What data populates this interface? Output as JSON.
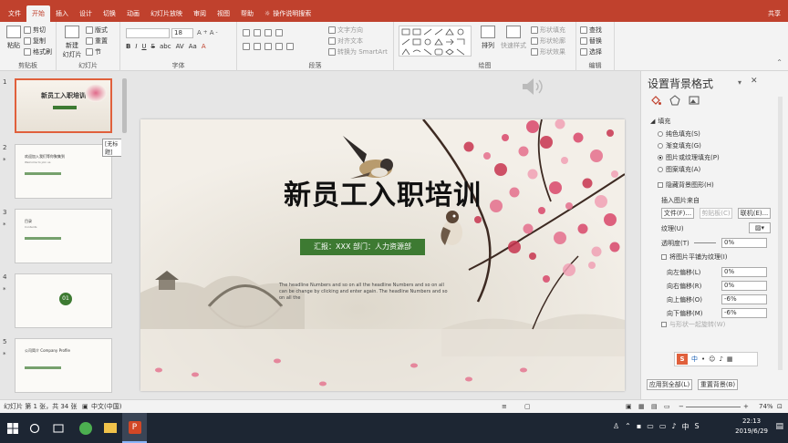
{
  "menu": {
    "tabs": [
      "文件",
      "开始",
      "插入",
      "设计",
      "切换",
      "动画",
      "幻灯片放映",
      "审阅",
      "视图",
      "帮助"
    ],
    "active_tab": "开始",
    "tell_me": "操作说明搜索",
    "share": "共享"
  },
  "ribbon": {
    "clipboard": {
      "paste": "粘贴",
      "cut": "剪切",
      "copy": "复制",
      "format_painter": "格式刷",
      "label": "剪贴板"
    },
    "slides": {
      "new_slide": "新建\n幻灯片",
      "layout": "版式",
      "reset": "重置",
      "section": "节",
      "label": "幻灯片"
    },
    "font": {
      "size": "18",
      "label": "字体",
      "buttons": [
        "B",
        "I",
        "U",
        "S",
        "abc",
        "AV",
        "Aa",
        "A"
      ]
    },
    "paragraph": {
      "text_direction": "文字方向",
      "align_text": "对齐文本",
      "smartart": "转换为 SmartArt",
      "label": "段落"
    },
    "drawing": {
      "arrange": "排列",
      "quick_styles": "快速样式",
      "shape_fill": "形状填充",
      "shape_outline": "形状轮廓",
      "shape_effects": "形状效果",
      "label": "绘图"
    },
    "editing": {
      "find": "查找",
      "replace": "替换",
      "select": "选择",
      "label": "编辑"
    }
  },
  "thumbnails": [
    {
      "num": "1",
      "star": "",
      "title": "新员工入职培训",
      "selected": true,
      "tooltip": "[无标题]"
    },
    {
      "num": "2",
      "star": "*",
      "title": "欢迎加入我们等你聚集到",
      "sub": "Welcome to join us"
    },
    {
      "num": "3",
      "star": "*",
      "title": "目录",
      "sub": "Contents"
    },
    {
      "num": "4",
      "star": "*",
      "title": "01",
      "sub": ""
    },
    {
      "num": "5",
      "star": "*",
      "title": "公司简介 Company Profile",
      "sub": ""
    }
  ],
  "slide": {
    "title": "新员工入职培训",
    "subtitle": "汇报：XXX   部门：人力资源部",
    "body": "The headline Numbers and so on all the headline Numbers and so on all can be change by clicking and enter again. The headline Numbers and so on all the",
    "colors": {
      "bar": "#3d7a32",
      "blossom": "#d8466a",
      "paper": "#f3efe8"
    }
  },
  "format_pane": {
    "title": "设置背景格式",
    "section": "填充",
    "fill_options": [
      {
        "label": "纯色填充(S)",
        "selected": false
      },
      {
        "label": "渐变填充(G)",
        "selected": false
      },
      {
        "label": "图片或纹理填充(P)",
        "selected": true
      },
      {
        "label": "图案填充(A)",
        "selected": false
      }
    ],
    "hide_bg": "隐藏背景图形(H)",
    "insert_from": "插入图片来自",
    "btn_file": "文件(F)...",
    "btn_clipboard": "剪贴板(C)",
    "btn_online": "联机(E)...",
    "texture": "纹理(U)",
    "transparency_label": "透明度(T)",
    "transparency": "0%",
    "tile": "将图片平铺为纹理(I)",
    "offsets": [
      {
        "label": "向左偏移(L)",
        "value": "0%"
      },
      {
        "label": "向右偏移(R)",
        "value": "0%"
      },
      {
        "label": "向上偏移(O)",
        "value": "-6%"
      },
      {
        "label": "向下偏移(M)",
        "value": "-6%"
      }
    ],
    "rotate_with_shape": "与形状一起旋转(W)",
    "apply_all": "应用到全部(L)",
    "reset_bg": "重置背景(B)"
  },
  "status": {
    "slide_info": "幻灯片 第 1 张，共 34 张",
    "language": "中文(中国)",
    "zoom": "74%"
  },
  "taskbar": {
    "time": "22:13",
    "date": "2019/6/29",
    "ime": "中"
  }
}
